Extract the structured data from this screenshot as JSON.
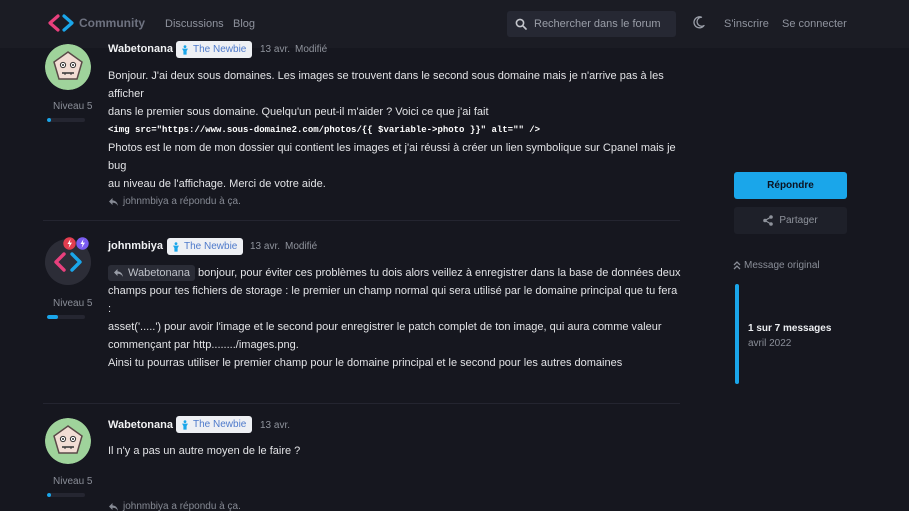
{
  "header": {
    "brand": "Community",
    "nav": [
      "Discussions",
      "Blog"
    ],
    "search_placeholder": "Rechercher dans le forum",
    "signup": "S'inscrire",
    "login": "Se connecter"
  },
  "colors": {
    "accent": "#1aa6ea",
    "background": "#16171f",
    "badge_text": "#4e7acb"
  },
  "posts": [
    {
      "username": "Wabetonana",
      "badge": "The Newbie",
      "date": "13 avr.",
      "modified": "Modifié",
      "level": "Niveau 5",
      "level_progress": 0.1,
      "avatar_icon": "pentagon-face-avatar",
      "lines": [
        "Bonjour. J'ai deux sous domaines. Les images se trouvent dans le second sous domaine mais je n'arrive pas à les afficher",
        "dans le premier sous domaine. Quelqu'un peut-il m'aider ? Voici ce que j'ai fait"
      ],
      "code": "<img src=\"https://www.sous-domaine2.com/photos/{{ $variable->photo }}\" alt=\"\" />",
      "lines_after": [
        "Photos est le nom de mon dossier qui contient les images et j'ai réussi à créer un lien symbolique sur Cpanel mais je bug",
        "au niveau de l'affichage. Merci de votre aide."
      ],
      "reply_note": "johnmbiya a répondu à ça."
    },
    {
      "username": "johnmbiya",
      "badge": "The Newbie",
      "date": "13 avr.",
      "modified": "Modifié",
      "level": "Niveau 5",
      "level_progress": 0.3,
      "avatar_icon": "code-logo-avatar",
      "mention": "Wabetonana",
      "first_line": "bonjour, pour éviter ces problèmes tu dois alors veillez à enregistrer dans la base de données deux",
      "lines": [
        "champs pour tes fichiers de storage : le premier un champ normal qui sera utilisé par le domaine principal que tu fera :",
        "asset('.....') pour avoir l'image et le second pour enregistrer le patch complet de ton image, qui aura comme valeur",
        "commençant par http......../images.png.",
        "Ainsi tu pourras utiliser le premier champ pour le domaine principal et le second pour les autres domaines"
      ]
    },
    {
      "username": "Wabetonana",
      "badge": "The Newbie",
      "date": "13 avr.",
      "level": "Niveau 5",
      "level_progress": 0.1,
      "avatar_icon": "pentagon-face-avatar",
      "lines": [
        "Il n'y a pas un autre moyen de le faire ?"
      ],
      "reply_note": "johnmbiya a répondu à ça."
    }
  ],
  "sidebar": {
    "reply_button": "Répondre",
    "share_button": "Partager",
    "original_message": "Message original",
    "scrubber_count": "1 sur 7 messages",
    "scrubber_date": "avril 2022"
  }
}
